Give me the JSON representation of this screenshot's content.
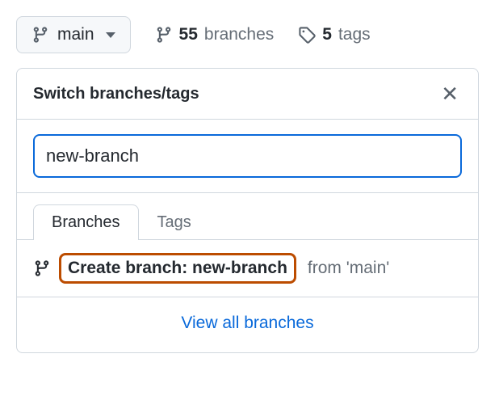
{
  "toolbar": {
    "current_branch": "main",
    "branches_count": "55",
    "branches_label": "branches",
    "tags_count": "5",
    "tags_label": "tags"
  },
  "popover": {
    "title": "Switch branches/tags",
    "input_value": "new-branch",
    "tabs": {
      "branches": "Branches",
      "tags": "Tags"
    },
    "create_prefix": "Create branch: ",
    "create_name": "new-branch",
    "from_text": "from 'main'",
    "view_all": "View all branches"
  }
}
